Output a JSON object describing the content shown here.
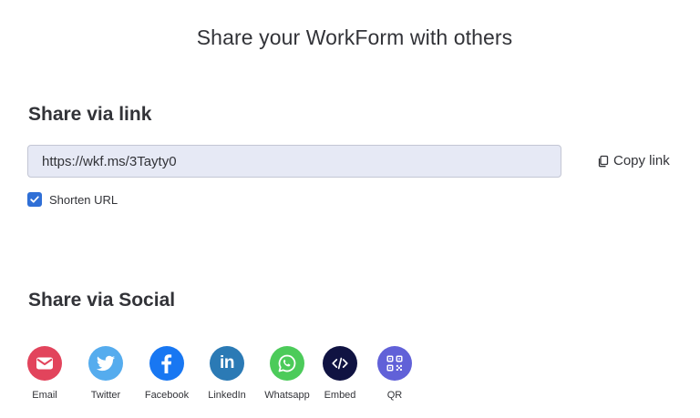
{
  "page": {
    "title": "Share your WorkForm with others"
  },
  "share_link": {
    "heading": "Share via link",
    "url_value": "https://wkf.ms/3Tayty0",
    "copy_label": "Copy link",
    "copy_icon": "copy-icon",
    "shorten_label": "Shorten URL",
    "shorten_checked": true
  },
  "social": {
    "heading": "Share via Social",
    "items": [
      {
        "label": "Email",
        "icon": "email-icon",
        "color": "#e2445c"
      },
      {
        "label": "Twitter",
        "icon": "twitter-icon",
        "color": "#55acee"
      },
      {
        "label": "Facebook",
        "icon": "facebook-icon",
        "color": "#1877f2"
      },
      {
        "label": "LinkedIn",
        "icon": "linkedin-icon",
        "color": "#2b7ab5"
      },
      {
        "label": "Whatsapp",
        "icon": "whatsapp-icon",
        "color": "#4ccb5a"
      },
      {
        "label": "Embed",
        "icon": "embed-icon",
        "color": "#101342"
      },
      {
        "label": "QR",
        "icon": "qr-icon",
        "color": "#6161d8"
      }
    ]
  },
  "colors": {
    "text": "#323338",
    "field_background": "#e6e9f5",
    "field_border": "#c3c6d4",
    "checkbox": "#2f6fd6"
  }
}
